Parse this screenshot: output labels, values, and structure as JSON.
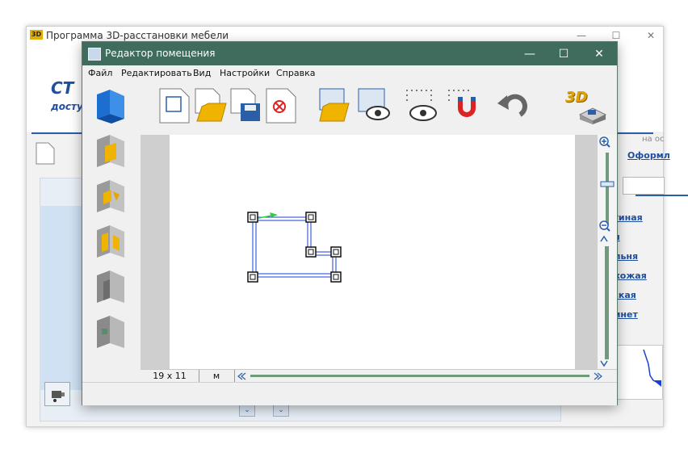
{
  "background_window": {
    "title": "Программа 3D-расстановки мебели",
    "icon_label": "3D",
    "logo_text": "СТ",
    "logo_subtext": "досту",
    "right_hint": "на ос",
    "tab_label": "Оформл",
    "room_links": [
      "стиная",
      "ня",
      "альня",
      "ихожая",
      "тская",
      "бинет"
    ]
  },
  "dialog": {
    "title": "Редактор помещения",
    "menu": [
      "Файл",
      "Редактировать",
      "Вид",
      "Настройки",
      "Справка"
    ],
    "status": {
      "size": "19 x 11",
      "unit": "м"
    },
    "toolbar_3d_label": "3D",
    "colors": {
      "title_bar": "#3f6c5d",
      "room_outline": "#1a3fd6",
      "accent": "#2a5fa8"
    }
  }
}
